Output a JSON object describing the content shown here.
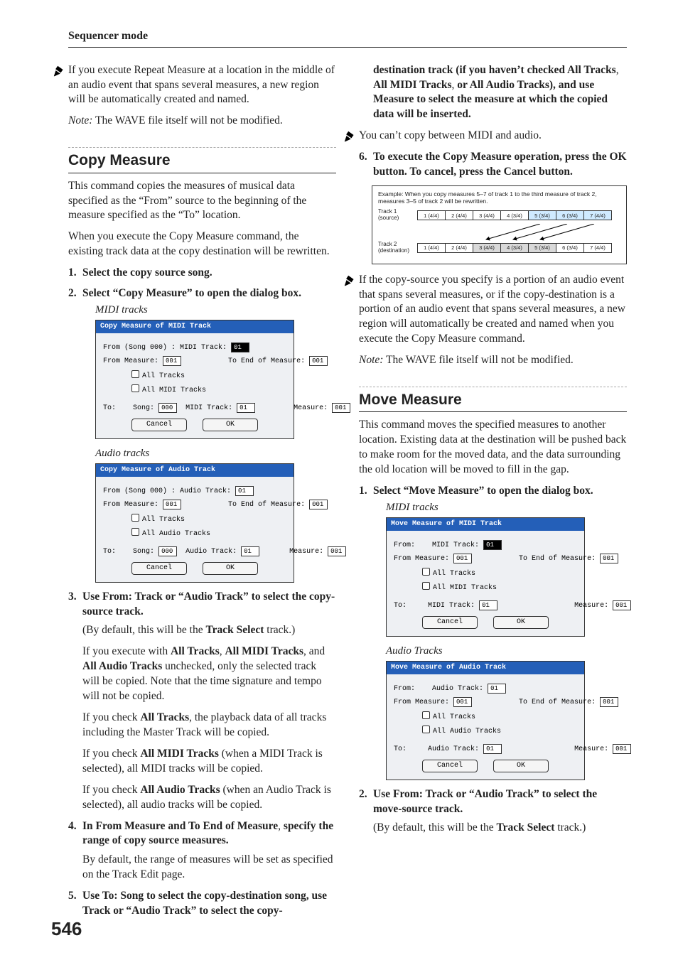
{
  "header": {
    "title": "Sequencer mode"
  },
  "page_number": "546",
  "left": {
    "warn1": "If you execute Repeat Measure at a location in the middle of an audio event that spans several measures, a new region will be automatically created and named.",
    "note1_label": "Note:",
    "note1": " The WAVE file itself will not be modified.",
    "h_copy": "Copy Measure",
    "p1": "This command copies the measures of musical data specified as the “From” source to the beginning of the measure specified as the “To” location.",
    "p2": "When you execute the Copy Measure command, the existing track data at the copy destination will be rewritten.",
    "steps": {
      "s1": "Select the copy source song.",
      "s2": "Select “Copy Measure” to open the dialog box.",
      "s2_sub1": "MIDI tracks",
      "s2_sub2": "Audio tracks",
      "s3_lead": "Use From: Track or “Audio Track” to select the copy-source track.",
      "s3_a": "(By default, this will be the ",
      "s3_a_b": "Track Select",
      "s3_a2": " track.)",
      "s3_b1": "If you execute with ",
      "s3_b_all": "All Tracks",
      "s3_b2": ", ",
      "s3_b_midi": "All MIDI Tracks",
      "s3_b3": ", and ",
      "s3_b_audio": "All Audio Tracks",
      "s3_b4": " unchecked, only the selected track will be copied. Note that the time signature and tempo will not be copied.",
      "s3_c1": "If you check ",
      "s3_c2": ", the playback data of all tracks including the Master Track will be copied.",
      "s3_d1": "If you check ",
      "s3_d2": " (when a MIDI Track is selected), all MIDI tracks will be copied.",
      "s3_e1": "If you check ",
      "s3_e2": " (when an Audio Track is selected), all audio tracks will be copied.",
      "s4_lead_a": "In From Measure and To End of Measure",
      "s4_lead_b": ", ",
      "s4_lead_c": "specify the range of copy source measures.",
      "s4_body": "By default, the range of measures will be set as specified on the Track Edit page.",
      "s5": "Use To: Song to select the copy-destination song, use Track or “Audio Track” to select the copy-"
    },
    "dlg_midi": {
      "title": "Copy Measure of MIDI Track",
      "from_line": "From (Song 000) :  MIDI Track:",
      "from_val": "01",
      "from_meas_l": "From Measure:",
      "from_meas_v": "001",
      "to_end_l": "To End of Measure:",
      "to_end_v": "001",
      "chk_all": "All Tracks",
      "chk_midi": "All MIDI Tracks",
      "to_l": "To:",
      "song_l": "Song:",
      "song_v": "000",
      "trk_l": "MIDI Track:",
      "trk_v": "01",
      "meas_l": "Measure:",
      "meas_v": "001",
      "cancel": "Cancel",
      "ok": "OK"
    },
    "dlg_audio": {
      "title": "Copy Measure of Audio Track",
      "from_line": "From (Song 000) :  Audio Track:",
      "from_val": "01",
      "from_meas_l": "From Measure:",
      "from_meas_v": "001",
      "to_end_l": "To End of Measure:",
      "to_end_v": "001",
      "chk_all": "All Tracks",
      "chk_audio": "All Audio Tracks",
      "to_l": "To:",
      "song_l": "Song:",
      "song_v": "000",
      "trk_l": "Audio Track:",
      "trk_v": "01",
      "meas_l": "Measure:",
      "meas_v": "001",
      "cancel": "Cancel",
      "ok": "OK"
    }
  },
  "right": {
    "cont1a": "destination track (if you haven’t checked All Tracks",
    "cont1b": ", ",
    "cont1c": "All MIDI Tracks",
    "cont1d": ", ",
    "cont1e": "or All Audio Tracks), and use Measure to select the measure at which the copied data will be inserted.",
    "warn2": "You can’t copy between MIDI and audio.",
    "s6": "To execute the Copy Measure operation, press the OK button. To cancel, press the Cancel button.",
    "diagram": {
      "caption": "Example: When you copy measures 5–7 of track 1 to the third measure of track 2, measures 3–5 of track 2 will be rewritten.",
      "t1": "Track 1\n(source)",
      "t2": "Track 2\n(destination)",
      "cells1": [
        "1 (4/4)",
        "2 (4/4)",
        "3 (4/4)",
        "4 (3/4)",
        "5 (3/4)",
        "6 (3/4)",
        "7 (4/4)"
      ],
      "cells2": [
        "1 (4/4)",
        "2 (4/4)",
        "3 (4/4)",
        "4 (3/4)",
        "5 (3/4)",
        "6 (3/4)",
        "7 (4/4)"
      ]
    },
    "warn3": "If the copy-source you specify is a portion of an audio event that spans several measures, or if the copy-destination is a portion of an audio event that spans several measures, a new region will automatically be created and named when you execute the Copy Measure command.",
    "note2_label": "Note:",
    "note2": " The WAVE file itself will not be modified.",
    "h_move": "Move Measure",
    "mp1": "This command moves the specified measures to another location. Existing data at the destination will be pushed back to make room for the moved data, and the data surrounding the old location will be moved to fill in the gap.",
    "msteps": {
      "s1": "Select “Move Measure” to open the dialog box.",
      "s1_sub1": "MIDI tracks",
      "s1_sub2": "Audio Tracks",
      "s2_lead": "Use From: Track or “Audio Track” to select the move-source track.",
      "s2_a": "(By default, this will be the ",
      "s2_a_b": "Track Select",
      "s2_a2": " track.)"
    },
    "mdlg_midi": {
      "title": "Move Measure of MIDI Track",
      "from_l": "From:",
      "trk_l": "MIDI Track:",
      "trk_v": "01",
      "from_meas_l": "From Measure:",
      "from_meas_v": "001",
      "to_end_l": "To End of Measure:",
      "to_end_v": "001",
      "chk_all": "All Tracks",
      "chk_midi": "All MIDI Tracks",
      "to_l": "To:",
      "to_trk_l": "MIDI Track:",
      "to_trk_v": "01",
      "meas_l": "Measure:",
      "meas_v": "001",
      "cancel": "Cancel",
      "ok": "OK"
    },
    "mdlg_audio": {
      "title": "Move Measure of Audio Track",
      "from_l": "From:",
      "trk_l": "Audio Track:",
      "trk_v": "01",
      "from_meas_l": "From Measure:",
      "from_meas_v": "001",
      "to_end_l": "To End of Measure:",
      "to_end_v": "001",
      "chk_all": "All Tracks",
      "chk_audio": "All Audio Tracks",
      "to_l": "To:",
      "to_trk_l": "Audio Track:",
      "to_trk_v": "01",
      "meas_l": "Measure:",
      "meas_v": "001",
      "cancel": "Cancel",
      "ok": "OK"
    }
  }
}
